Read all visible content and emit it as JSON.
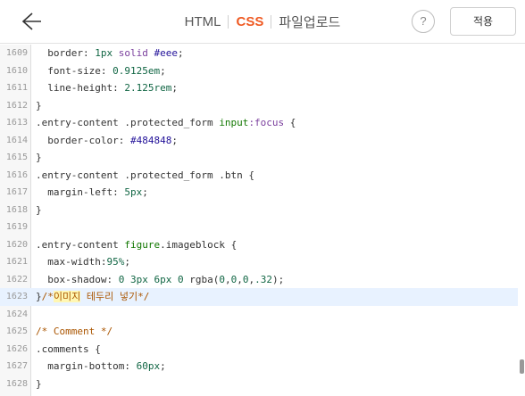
{
  "header": {
    "tabs": [
      {
        "label": "HTML",
        "active": false
      },
      {
        "label": "CSS",
        "active": true
      },
      {
        "label": "파일업로드",
        "active": false
      }
    ],
    "help_label": "?",
    "apply_label": "적용"
  },
  "colors": {
    "accent": "#ef5a23",
    "active_line": "#e8f2ff"
  },
  "editor": {
    "lines": [
      {
        "num": "1609",
        "tokens": [
          [
            "  ",
            "plain"
          ],
          [
            "border",
            "prop"
          ],
          [
            ": ",
            "plain"
          ],
          [
            "1px",
            "num"
          ],
          [
            " ",
            "plain"
          ],
          [
            "solid",
            "kw"
          ],
          [
            " ",
            "plain"
          ],
          [
            "#eee",
            "hex"
          ],
          [
            ";",
            "plain"
          ]
        ]
      },
      {
        "num": "1610",
        "tokens": [
          [
            "  ",
            "plain"
          ],
          [
            "font-size",
            "prop"
          ],
          [
            ": ",
            "plain"
          ],
          [
            "0.9125em",
            "num"
          ],
          [
            ";",
            "plain"
          ]
        ]
      },
      {
        "num": "1611",
        "tokens": [
          [
            "  ",
            "plain"
          ],
          [
            "line-height",
            "prop"
          ],
          [
            ": ",
            "plain"
          ],
          [
            "2.125rem",
            "num"
          ],
          [
            ";",
            "plain"
          ]
        ]
      },
      {
        "num": "1612",
        "tokens": [
          [
            "}",
            "plain"
          ]
        ]
      },
      {
        "num": "1613",
        "tokens": [
          [
            ".entry-content .protected_form ",
            "sel"
          ],
          [
            "input",
            "tag"
          ],
          [
            ":focus",
            "pseudo"
          ],
          [
            " {",
            "plain"
          ]
        ]
      },
      {
        "num": "1614",
        "tokens": [
          [
            "  ",
            "plain"
          ],
          [
            "border-color",
            "prop"
          ],
          [
            ": ",
            "plain"
          ],
          [
            "#484848",
            "hex"
          ],
          [
            ";",
            "plain"
          ]
        ]
      },
      {
        "num": "1615",
        "tokens": [
          [
            "}",
            "plain"
          ]
        ]
      },
      {
        "num": "1616",
        "tokens": [
          [
            ".entry-content .protected_form .btn {",
            "sel"
          ]
        ]
      },
      {
        "num": "1617",
        "tokens": [
          [
            "  ",
            "plain"
          ],
          [
            "margin-left",
            "prop"
          ],
          [
            ": ",
            "plain"
          ],
          [
            "5px",
            "num"
          ],
          [
            ";",
            "plain"
          ]
        ]
      },
      {
        "num": "1618",
        "tokens": [
          [
            "}",
            "plain"
          ]
        ]
      },
      {
        "num": "1619",
        "tokens": []
      },
      {
        "num": "1620",
        "tokens": [
          [
            ".entry-content ",
            "sel"
          ],
          [
            "figure",
            "tag"
          ],
          [
            ".imageblock {",
            "sel"
          ]
        ]
      },
      {
        "num": "1621",
        "tokens": [
          [
            "  ",
            "plain"
          ],
          [
            "max-width",
            "prop"
          ],
          [
            ":",
            "plain"
          ],
          [
            "95%",
            "num"
          ],
          [
            ";",
            "plain"
          ]
        ]
      },
      {
        "num": "1622",
        "tokens": [
          [
            "  ",
            "plain"
          ],
          [
            "box-shadow",
            "prop"
          ],
          [
            ": ",
            "plain"
          ],
          [
            "0",
            "num"
          ],
          [
            " ",
            "plain"
          ],
          [
            "3px",
            "num"
          ],
          [
            " ",
            "plain"
          ],
          [
            "6px",
            "num"
          ],
          [
            " ",
            "plain"
          ],
          [
            "0",
            "num"
          ],
          [
            " rgba(",
            "plain"
          ],
          [
            "0",
            "num"
          ],
          [
            ",",
            "plain"
          ],
          [
            "0",
            "num"
          ],
          [
            ",",
            "plain"
          ],
          [
            "0",
            "num"
          ],
          [
            ",",
            "plain"
          ],
          [
            ".32",
            "num"
          ],
          [
            ");",
            "plain"
          ]
        ]
      },
      {
        "num": "1623",
        "active": true,
        "tokens": [
          [
            "}",
            "plain"
          ],
          [
            "/*",
            "comment"
          ],
          [
            "이미지",
            "comment-hl"
          ],
          [
            " 테두리 넣기*/",
            "comment"
          ]
        ]
      },
      {
        "num": "1624",
        "tokens": []
      },
      {
        "num": "1625",
        "tokens": [
          [
            "/* Comment */",
            "comment"
          ]
        ]
      },
      {
        "num": "1626",
        "tokens": [
          [
            ".comments {",
            "sel"
          ]
        ]
      },
      {
        "num": "1627",
        "tokens": [
          [
            "  ",
            "plain"
          ],
          [
            "margin-bottom",
            "prop"
          ],
          [
            ": ",
            "plain"
          ],
          [
            "60px",
            "num"
          ],
          [
            ";",
            "plain"
          ]
        ]
      },
      {
        "num": "1628",
        "tokens": [
          [
            "}",
            "plain"
          ]
        ]
      }
    ]
  }
}
